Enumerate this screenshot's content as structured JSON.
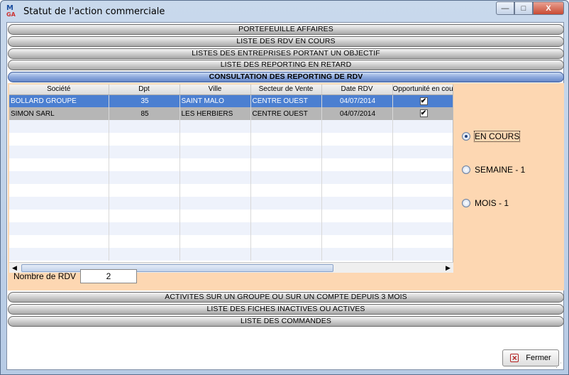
{
  "window": {
    "title": "Statut de l'action commerciale",
    "icon_text": "M",
    "icon_sub": "GA",
    "minimize": "—",
    "maximize": "□",
    "close": "X"
  },
  "sections_top": [
    "PORTEFEUILLE AFFAIRES",
    "LISTE DES RDV EN COURS",
    "LISTES DES ENTREPRISES PORTANT UN OBJECTIF",
    "LISTE DES REPORTING EN RETARD",
    "CONSULTATION DES REPORTING DE RDV"
  ],
  "grid": {
    "columns": [
      "Société",
      "Dpt",
      "Ville",
      "Secteur de Vente",
      "Date RDV",
      "Opportunité en cou"
    ],
    "rows": [
      {
        "societe": "BOLLARD GROUPE",
        "dpt": "35",
        "ville": "SAINT MALO",
        "secteur": "CENTRE OUEST",
        "date": "04/07/2014",
        "opportunite": true
      },
      {
        "societe": "SIMON SARL",
        "dpt": "85",
        "ville": "LES HERBIERS",
        "secteur": "CENTRE OUEST",
        "date": "04/07/2014",
        "opportunite": true
      }
    ],
    "check_glyph": "✔",
    "scroll_left": "◀",
    "scroll_right": "▶"
  },
  "count": {
    "label": "Nombre de RDV",
    "value": "2"
  },
  "period_options": [
    {
      "label": "EN COURS",
      "selected": true
    },
    {
      "label": "SEMAINE - 1",
      "selected": false
    },
    {
      "label": "MOIS - 1",
      "selected": false
    }
  ],
  "sections_bottom": [
    "ACTIVITES SUR UN GROUPE OU SUR UN COMPTE DEPUIS 3 MOIS",
    "LISTE DES FICHES INACTIVES OU ACTIVES",
    "LISTE DES COMMANDES"
  ],
  "close_button": {
    "label": "Fermer",
    "icon": "x-icon"
  }
}
